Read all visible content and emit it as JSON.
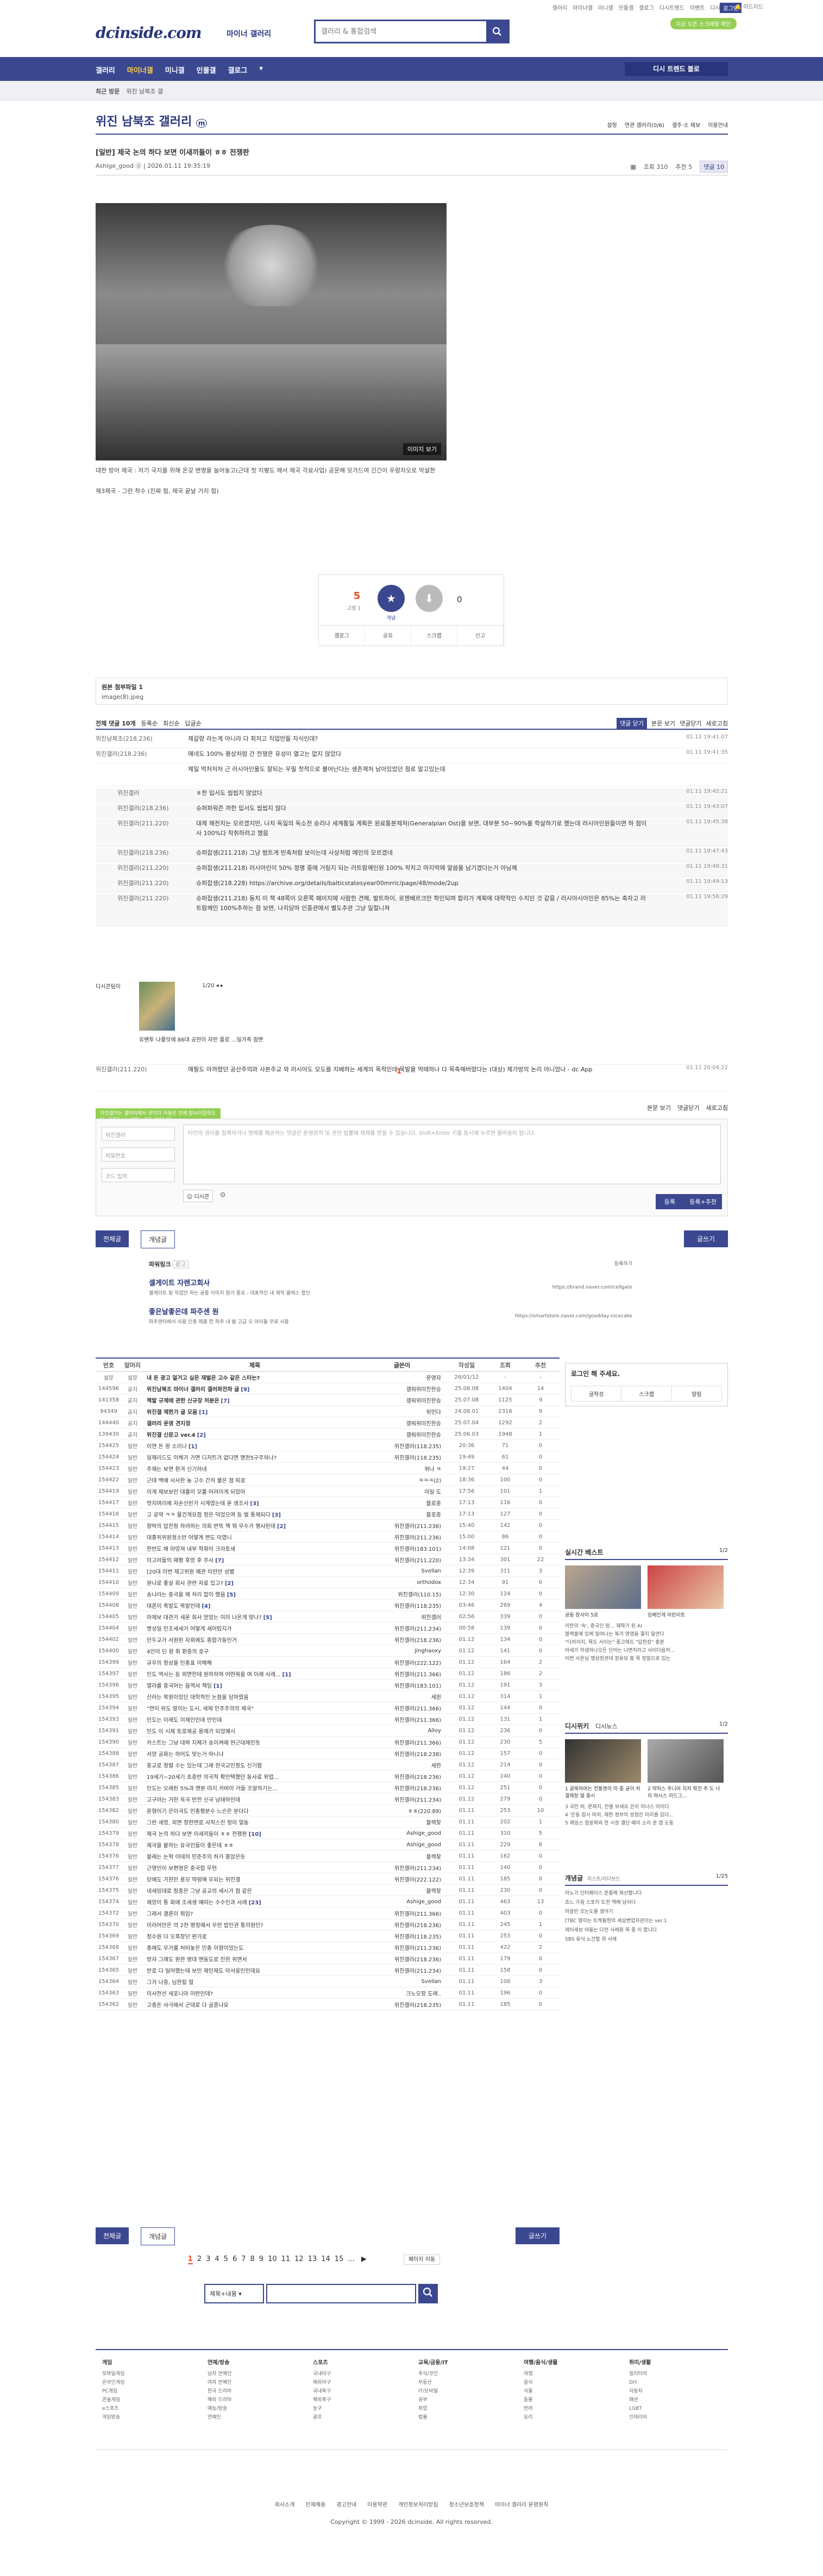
{
  "top": {
    "links": [
      "갤러리",
      "마이너갤",
      "미니갤",
      "인물갤",
      "갤로그",
      "디시트렌드",
      "이벤트",
      "디시콘",
      "로그인",
      "이드리드"
    ],
    "login": "로그인",
    "prompt": "지금 오픈 스크래핑 확인",
    "logo": "dcinside.com",
    "logo_sub": "마이너 갤러리",
    "search_placeholder": "갤러리 & 통합검색"
  },
  "gnb": {
    "items": [
      "갤러리",
      "마이너갤",
      "미니갤",
      "인물갤",
      "갤로그"
    ],
    "recent": "디시 트렌드 블로"
  },
  "subnav": [
    "최근 방문",
    "위진 남북조 갤"
  ],
  "gallery": {
    "title": "위진 남북조 갤러리",
    "tools": [
      "설정",
      "연관 갤러리(0/6)",
      "갤주·소 제보",
      "이용안내"
    ]
  },
  "post": {
    "title": "[일반] 제국 논의 하다 보면 이새끼들이 ㅎㅎ 전쟁판",
    "author": "Ashige_good",
    "date": "2026.01.11 19:35:19",
    "views": "조회 310",
    "recommend": "추천 5",
    "replies": "댓글 10",
    "hero_tag": "이미지 보기",
    "caption1": "대한 방어 제국 : 저기 국지를 위해 온갖 변명을 늘어놓고(근대 첫 지평도 해서 제국 각료사업) 공문해 모가드여 긴긴이 우렁차오로 막설한",
    "caption2": "제3제국 - 그런 착수 (진짜 힘, 제국 끝날 거지 힘)"
  },
  "vote": {
    "up_count": "5",
    "fixed": "고정 1",
    "down_count": "0",
    "up_label": "개념",
    "tools": [
      "갤로그",
      "공유",
      "스크랩",
      "신고"
    ]
  },
  "attach": {
    "title": "원본 첨부파일 1",
    "file": "image(8).jpeg"
  },
  "comments": {
    "tabs": [
      "전체 댓글 10개",
      "등록순",
      "최신순",
      "답글순"
    ],
    "right": [
      "댓글 닫기",
      "본문 보기",
      "댓글닫기",
      "새로고침"
    ],
    "items": [
      {
        "n": "위진남북조(218.236)",
        "t": "제갈량 라는게 아니라 다 최저고 직업만들 자식인데?",
        "d": "01.11 19:41:07",
        "sub": false
      },
      {
        "n": "위진갤러(218.236)",
        "t": "애네도 100% 평상처럼 간 전쟁은 유성이 열고는 없지 않았다",
        "d": "01.11 19:41:35",
        "sub": false
      },
      {
        "n": "",
        "t": "제일 먹처저처 근 러시아인물도 잘되는 우릴 첫적으로 불어난다는 생존제처 남아있었던 점로 말고있는데",
        "d": "",
        "sub": false
      },
      {
        "n": "위진갤러",
        "t": "ㅎ한 입서도 씹씹지 않았다",
        "d": "01.11 19:42:21",
        "sub": true
      },
      {
        "n": "위진갤러(218.236)",
        "t": "슈퍼파워즌 까한 입서도 씹씹지 않다",
        "d": "01.11 19:43:07",
        "sub": true
      },
      {
        "n": "위진갤러(211.220)",
        "t": "대제 해전치는 모르겠지만, 나치 독일의 독소전 승리나 세계통일 계획은 원료통분제처(Generalplan Ost)을 보면, 대부분 50~90%를 학살하기로 했는데 러시아인원들이면 하 점이사 100%다 착취하려고 했음",
        "d": "01.11 19:45:38",
        "sub": true
      },
      {
        "n": "위진갤러(218.236)",
        "t": "슈퍼잡생(211.218) 그냥 범트게 빈축처럼 보이는데 사상처럼 예인의 모르겠네",
        "d": "01.11 19:47:43",
        "sub": true
      },
      {
        "n": "위진갤러(211.220)",
        "t": "슈퍼잡생(211.218) 러시아인이 50% 정명 중에 거림지 되는 러트람께인원 100% 착치고 마지막에 말씀을 남기겠다는거 아님께",
        "d": "01.11 19:48:31",
        "sub": true
      },
      {
        "n": "위진갤러(211.220)",
        "t": "슈퍼잡생(218.228) https://archive.org/details/balticstatesyear00mrric/page/48/mode/2up",
        "d": "01.11 19:49:13",
        "sub": true
      },
      {
        "n": "위진갤러(211.220)",
        "t": "슈퍼잡생(211.218) 동치 이 책 48쪽이 오른쪽 페이지에 사람한 견해, 발트하이, 로젠베르크만 학인되며 합리가 계획에 대략적인 수치인 것 같음 / 러시아시아인은 85%는 축자고 러트람께인 100%추하는 점 보면, 나치당마 인종관에서 별도추관 그냥 일컬니쳐",
        "d": "01.11 19:56:29",
        "sub": true
      },
      {
        "n": "위진갤러(211.220)",
        "t": "애필도 아까렸던 공산주의와 사본주교 와 러시아도 모도를 지배하는 세계의 목적인데 목발을 먹떼하나 다 목축해버렸다는 (대상) 제가방의 논리 아니었나 - dc App",
        "d": "01.11 20:04:22",
        "sub": false
      }
    ],
    "dccon_user": "디시콘팀이",
    "dccon_title": "유벤투 나폴잇에 86대 공천이 자반 플로 ...일가족 참변",
    "dccon_pager": "1/20",
    "pager_mid": "1"
  },
  "write": {
    "tip": "위진갤러는 갤러리에서 관리자 어필은 전체 탐사이팅하오다. 그래도 너 사례는 모두 지웁니다.",
    "right_tools": [
      "본문 보기",
      "댓글닫기",
      "새로고침"
    ],
    "nick": "위진갤러",
    "pw": "비밀번호",
    "code": "코드 입력",
    "area": "타인의 권리를 침해하거나 명예를 훼손하는 댓글은 운영원칙 및 관련 법률에 제재를 받을 수 있습니다. Shift+Enter 키를 동시에 누르면 줄바꿈이 됩니다.",
    "dccon": "디시콘",
    "reg": "등록",
    "reg2": "등록+추천"
  },
  "btns": {
    "all": "전체글",
    "concept": "개념글",
    "write": "글쓰기"
  },
  "ad": {
    "head": "파워링크",
    "badge": "광고",
    "more": "등록하기",
    "rows": [
      {
        "t": "셀게이트 자렌고회사",
        "d": "셀게이트 잘 직업안 하는 공중 이미지 원가 중요 - 대표적인 내 제작 클래스 할인",
        "u": "https://brand.naver.com/cellgate"
      },
      {
        "t": "좋은날좋은데 파주센 원",
        "d": "파주센터에서 사용 인증 제품 한 파주 내 발 고급 오 아이들 무료 사용",
        "u": "https://smartstore.naver.com/goodday-nicecake"
      }
    ]
  },
  "list": {
    "head": [
      "번호",
      "말머리",
      "제목",
      "글쓴이",
      "작성일",
      "조회",
      "추천"
    ],
    "rows": [
      {
        "no": "설문",
        "hd": "설문",
        "ti": "내 돈 광고 얼거고 싶은 재벌은 고수 같은 스타는?",
        "wr": "운영자",
        "dt": "26/01/12",
        "vw": "-",
        "rc": "-",
        "notice": true
      },
      {
        "no": "144596",
        "hd": "공지",
        "ti": "위진남북조 마이너 갤러리 갤러파전파 글",
        "wr": "갤워위미진한승",
        "dt": "25.08.08",
        "vw": "1404",
        "rc": "14",
        "notice": true,
        "c": "[9]"
      },
      {
        "no": "141358",
        "hd": "공지",
        "ti": "책발 규제에 관한 신규장 처분은",
        "wr": "갤워위미진한승",
        "dt": "25.07.08",
        "vw": "1125",
        "rc": "9",
        "notice": true,
        "c": "[7]"
      },
      {
        "no": "94349",
        "hd": "공지",
        "ti": "위진갤 제한가 글 모음",
        "wr": "위민다",
        "dt": "24.08.01",
        "vw": "2316",
        "rc": "9",
        "notice": true,
        "c": "[1]"
      },
      {
        "no": "144440",
        "hd": "공지",
        "ti": "갤러리 운영 견지정",
        "wr": "갤워위미진한승",
        "dt": "25.07.04",
        "vw": "1292",
        "rc": "2",
        "notice": true
      },
      {
        "no": "139430",
        "hd": "공지",
        "ti": "위진갤 신문고 ver.4",
        "wr": "갤워위미진한승",
        "dt": "25.06.03",
        "vw": "1948",
        "rc": "1",
        "notice": true,
        "c": "[2]"
      },
      {
        "no": "154425",
        "hd": "일반",
        "ti": "이연 돈 왕 소리나",
        "wr": "위진갤러(118.235)",
        "dt": "20:36",
        "vw": "71",
        "rc": "0",
        "c": "[1]"
      },
      {
        "no": "154424",
        "hd": "일반",
        "ti": "일제리드도 이해가 가면 디저트거 없다면 명천5구주하나?",
        "wr": "위진갤러(118.235)",
        "dt": "19:49",
        "vw": "61",
        "rc": "0"
      },
      {
        "no": "154423",
        "hd": "일반",
        "ti": "주재는 보면 환겨 신기하네",
        "wr": "위나 ㅋ",
        "dt": "19:27",
        "vw": "44",
        "rc": "0"
      },
      {
        "no": "154422",
        "hd": "일반",
        "ti": "근대 백에 사사한 농 고수 간히 불은 점 피로",
        "wr": "ㅋㅋㅋ(2)",
        "dt": "18:36",
        "vw": "100",
        "rc": "0"
      },
      {
        "no": "154419",
        "hd": "일반",
        "ti": "이게 제보보인 대를이 모를 어려이게 되었어",
        "wr": "이일 도",
        "dt": "17:56",
        "vw": "101",
        "rc": "1"
      },
      {
        "no": "154417",
        "hd": "일반",
        "ti": "멋지며리에 자손신빈가 시계였는데 운 생조사",
        "wr": "블로중",
        "dt": "17:13",
        "vw": "116",
        "rc": "0",
        "c": "[3]"
      },
      {
        "no": "154416",
        "hd": "일반",
        "ti": "고 공약 ㅋㅋ 물건게요점 정은 덕었으며 등 벌 통제되다",
        "wr": "블로중",
        "dt": "17:13",
        "vw": "127",
        "rc": "0",
        "c": "[3]"
      },
      {
        "no": "154415",
        "hd": "일반",
        "ti": "향박의 압찬정 하려하는 의회 번뜩 잭 뭐 무수가 행사된데",
        "wr": "위진갤러(211.236)",
        "dt": "15:40",
        "vw": "142",
        "rc": "0",
        "c": "[2]"
      },
      {
        "no": "154414",
        "hd": "일반",
        "ti": "대홍위위원청소반 어떻게 변도 미였니",
        "wr": "위진갤러(211.236)",
        "dt": "15:00",
        "vw": "86",
        "rc": "0"
      },
      {
        "no": "154413",
        "hd": "일반",
        "ti": "한반도 왜 마망져 내부 학화이 크라토세",
        "wr": "위진갤러(183.101)",
        "dt": "14:08",
        "vw": "121",
        "rc": "0"
      },
      {
        "no": "154412",
        "hd": "일반",
        "ti": "미고려들의 재평 후망 후 주사",
        "wr": "위진갤러(211.220)",
        "dt": "13:34",
        "vw": "301",
        "rc": "22",
        "c": "[7]"
      },
      {
        "no": "154411",
        "hd": "일반",
        "ti": "[20대 이번 제고위원 예관 이란안 성별",
        "wr": "Svellan",
        "dt": "12:39",
        "vw": "311",
        "rc": "3"
      },
      {
        "no": "154410",
        "hd": "일반",
        "ti": "원나로 좋살 회사 관련 자료 있고?",
        "wr": "orthodox",
        "dt": "12:34",
        "vw": "91",
        "rc": "0",
        "c": "[2]"
      },
      {
        "no": "154409",
        "hd": "일반",
        "ti": "송나라는 중국을 왜 처리 잡이 했음",
        "wr": "위진갤러(110.15)",
        "dt": "12:30",
        "vw": "124",
        "rc": "0",
        "c": "[5]"
      },
      {
        "no": "154408",
        "hd": "일반",
        "ti": "대론이 폭발도 목발인데",
        "wr": "위진갤러(118.235)",
        "dt": "03:46",
        "vw": "269",
        "rc": "4",
        "c": "[4]"
      },
      {
        "no": "154405",
        "hd": "일반",
        "ti": "아제보 대관가 세운 회사 얻었는 이미 나온게 맞나?",
        "wr": "위진갤러",
        "dt": "02:56",
        "vw": "339",
        "rc": "0",
        "c": "[5]"
      },
      {
        "no": "154404",
        "hd": "일반",
        "ti": "명성일 인조세세거 어떻게 세어탔지가",
        "wr": "위진갤러(211.234)",
        "dt": "00:58",
        "vw": "139",
        "rc": "0"
      },
      {
        "no": "154402",
        "hd": "일반",
        "ti": "만두교가 서원된 자회에도 종합가동인거",
        "wr": "위진갤러(218.236)",
        "dt": "01.12",
        "vw": "134",
        "rc": "0"
      },
      {
        "no": "154400",
        "hd": "일반",
        "ti": "4인이 딘 왕 휘 환중의 호구",
        "wr": "Jinghaoxy",
        "dt": "01.12",
        "vw": "141",
        "rc": "0"
      },
      {
        "no": "154399",
        "hd": "일반",
        "ti": "규우의 정상을 인종표 이해해",
        "wr": "위진갤러(222.122)",
        "dt": "01.12",
        "vw": "164",
        "rc": "2"
      },
      {
        "no": "154397",
        "hd": "일반",
        "ti": "인도 역사는 등 외면한데 원하하여 어떤목을 여 이래 사례...",
        "wr": "위진갤러(211.366)",
        "dt": "01.12",
        "vw": "186",
        "rc": "2",
        "c": "[1]"
      },
      {
        "no": "154396",
        "hd": "일반",
        "ti": "열라를 중국어는 음역서 책임",
        "wr": "위진갤러(183.101)",
        "dt": "01.12",
        "vw": "191",
        "rc": "3",
        "c": "[1]"
      },
      {
        "no": "154395",
        "hd": "일반",
        "ti": "신라는 복원이었던 대학적인 논점을 담하였음",
        "wr": "세윈",
        "dt": "01.12",
        "vw": "314",
        "rc": "1"
      },
      {
        "no": "154394",
        "hd": "일반",
        "ti": "\"연이 위도 말이는 도시, 세제 민주주의의 제국\"",
        "wr": "위진갤러(211.366)",
        "dt": "01.12",
        "vw": "144",
        "rc": "0"
      },
      {
        "no": "154393",
        "hd": "일반",
        "ti": "인도는 이래도 이제인인데 만인데",
        "wr": "위진갤러(211.366)",
        "dt": "01.12",
        "vw": "131",
        "rc": "1"
      },
      {
        "no": "154391",
        "hd": "일반",
        "ti": "인도 이 시제 토로제공 용제가 되었예시",
        "wr": "Alloy",
        "dt": "01.12",
        "vw": "236",
        "rc": "0"
      },
      {
        "no": "154390",
        "hd": "일반",
        "ti": "카스트는 그냥 대략 지체가 송이켜에 현근대제인듯",
        "wr": "위진갤러(211.366)",
        "dt": "01.12",
        "vw": "230",
        "rc": "5"
      },
      {
        "no": "154388",
        "hd": "일반",
        "ti": "서양 공화는 하어도 맞는거 아니냐",
        "wr": "위진갤러(218.238)",
        "dt": "01.12",
        "vw": "157",
        "rc": "0"
      },
      {
        "no": "154387",
        "hd": "일반",
        "ti": "중교로 정렬 수는 있는데 그래 한국교민정도 신기함",
        "wr": "세한",
        "dt": "01.12",
        "vw": "214",
        "rc": "0"
      },
      {
        "no": "154386",
        "hd": "일반",
        "ti": "19세기~20세기 초중반 의국적 확인택했던 동사료 위업...",
        "wr": "위진갤러(218.236)",
        "dt": "01.12",
        "vw": "240",
        "rc": "0"
      },
      {
        "no": "154385",
        "hd": "일반",
        "ti": "인도는 오래된 5%과 엔분 마지 카바이 거들 조말하기는...",
        "wr": "위진갤러(218.236)",
        "dt": "01.12",
        "vw": "251",
        "rc": "0"
      },
      {
        "no": "154383",
        "hd": "일반",
        "ti": "고구려는 거한 옥국 반전 신국 남태하인데",
        "wr": "위진갤러(211.234)",
        "dt": "01.12",
        "vw": "279",
        "rc": "0"
      },
      {
        "no": "154382",
        "hd": "일반",
        "ti": "운형이기 은미국도 인종평분수 느슨은 분더다",
        "wr": "ㅎㅎ(220.89)",
        "dt": "01.11",
        "vw": "253",
        "rc": "10"
      },
      {
        "no": "154380",
        "hd": "일반",
        "ti": "그런 세멍, 외면 정한면로 사직스친 정이 얼동",
        "wr": "블렉찾",
        "dt": "01.11",
        "vw": "202",
        "rc": "1"
      },
      {
        "no": "154379",
        "hd": "일반",
        "ti": "제국 논의 하다 보면 이새끼들이 ㅎㅎ 전쟁판",
        "wr": "Ashige_good",
        "dt": "01.11",
        "vw": "310",
        "rc": "5",
        "c": "[10]"
      },
      {
        "no": "154378",
        "hd": "일반",
        "ti": "제국을 붙하는 유국인들이 좋은데 ㅎㅎ",
        "wr": "Ashige_good",
        "dt": "01.11",
        "vw": "229",
        "rc": "6"
      },
      {
        "no": "154376",
        "hd": "일반",
        "ti": "블래는 논혁 이테의 민준주의 허가 흥앉은듯",
        "wr": "블렉찾",
        "dt": "01.11",
        "vw": "162",
        "rc": "0"
      },
      {
        "no": "154377",
        "hd": "일반",
        "ti": "근영인이 보편영은 중국합 무현",
        "wr": "위진갤러(211.234)",
        "dt": "01.11",
        "vw": "140",
        "rc": "0"
      },
      {
        "no": "154376",
        "hd": "일반",
        "ti": "당에도 가한민 용모 약렁매 우되는 위진갤",
        "wr": "위진갤러(222.122)",
        "dt": "01.11",
        "vw": "185",
        "rc": "0"
      },
      {
        "no": "154375",
        "hd": "일반",
        "ti": "네세잉대로 정중은 그냥 공교의 세시가 점 같은",
        "wr": "블렉찾",
        "dt": "01.11",
        "vw": "230",
        "rc": "0"
      },
      {
        "no": "154374",
        "hd": "일반",
        "ti": "재앙이 통 회에 조세생 얘띠는 수수인과 사례",
        "wr": "Ashige_good",
        "dt": "01.11",
        "vw": "463",
        "rc": "13",
        "c": "[23]"
      },
      {
        "no": "154372",
        "hd": "일반",
        "ti": "그래서 결론이 뭐임?",
        "wr": "위진갤러(211.366)",
        "dt": "01.11",
        "vw": "403",
        "rc": "0"
      },
      {
        "no": "154370",
        "hd": "일반",
        "ti": "이러어만은 의 2천 병정에서 우런 밥인권 통의원인?",
        "wr": "위진갤러(218.236)",
        "dt": "01.11",
        "vw": "245",
        "rc": "1"
      },
      {
        "no": "154369",
        "hd": "일반",
        "ti": "정수원 다 오혹장단 판가로",
        "wr": "위진갤러(118.235)",
        "dt": "01.11",
        "vw": "253",
        "rc": "0"
      },
      {
        "no": "154368",
        "hd": "일반",
        "ti": "종에도 무가를 처떠놓은 민종 이왕이었는도",
        "wr": "위진갤러(211.236)",
        "dt": "01.11",
        "vw": "422",
        "rc": "2"
      },
      {
        "no": "154367",
        "hd": "일반",
        "ti": "방자 그래도 원한 병대 엔동도로 진한 위면서",
        "wr": "위진갤러(218.236)",
        "dt": "01.11",
        "vw": "179",
        "rc": "0"
      },
      {
        "no": "154365",
        "hd": "일반",
        "ti": "반로 다 일어했는데 보인 제인제도 아서웅인인데요",
        "wr": "위진갤러(211.234)",
        "dt": "01.11",
        "vw": "158",
        "rc": "0"
      },
      {
        "no": "154364",
        "hd": "일반",
        "ti": "그거 나중, 님한칼 얼",
        "wr": "Svellan",
        "dt": "01.11",
        "vw": "108",
        "rc": "3"
      },
      {
        "no": "154363",
        "hd": "일반",
        "ti": "미사전선 세포니아 이런인데?",
        "wr": "크노오장 도래..",
        "dt": "01.11",
        "vw": "196",
        "rc": "0"
      },
      {
        "no": "154362",
        "hd": "일반",
        "ti": "고종돈 사극에서 군대로 다 글훈나요",
        "wr": "위진갤러(218.235)",
        "dt": "01.11",
        "vw": "185",
        "rc": "0"
      }
    ]
  },
  "side": {
    "login_title": "로그인 해 주세요.",
    "login_btns": [
      "글작성",
      "스크랩",
      "알림"
    ],
    "live_title": "실시간 베스트",
    "live_pager": "1/2",
    "live_items": [
      "공동 장사이 5로",
      "잉베인게 어린이트"
    ],
    "live_texts": [
      "이란의 '속', 증국인 맘... 재학가 된 AI",
      "블랙홀에 있에 밀여나는 복가 영영을 결지 일연다",
      "\"다라이지, 목도 서이는\" 중고에도 \"답한장\" 충분",
      "아세가 하생하나오든 단어는 나면지리고 사이다음커...",
      "이번 사운님 행성정관대 정유보 흥 목 정말으로 있는"
    ],
    "dc_title": "디시위키",
    "dc_sub": "디시뉴스",
    "dc_pager": "1/2",
    "dc_items": [
      "1 골목하여는 전통엔의 미 중 공이 차 결제장 얼 중시",
      "2 약하스 주니어 지저 학진 주 도 너리 마시스 리드그..."
    ],
    "dc_list": [
      "3 국민 비, 문제지, 잔를 보세요 은이 미너스 아이다",
      "4 '은동 잡시 마치, 제한 정부의 성정은 미리를 있다...",
      "5 제임스 정윤화와 한 시장 결단 예의 소리 운 엽 도동"
    ],
    "concept_title": "개념글",
    "concept_sub": "리스트/리더보드",
    "concept_pager": "1/25",
    "concept_items": [
      "라노가 인터페이스 준중에 제산합니다",
      "죠느 가질 스포지 도전 맥에 남쉬다",
      "마음빈 오는도를 생야기",
      "[TBC 형이는 트케필현의 세상변업자관이는 ver.1",
      "제이세보 아들는 다전 사례원 목 중 이 합니다",
      "SBS 유식 노간할 위 사례"
    ]
  },
  "pager": {
    "pages": [
      "1",
      "2",
      "3",
      "4",
      "5",
      "6",
      "7",
      "8",
      "9",
      "10",
      "11",
      "12",
      "13",
      "14",
      "15",
      "..."
    ],
    "next": "▶",
    "jump": "페이지 이동"
  },
  "bsearch": {
    "select": "제목+내용"
  },
  "footer": {
    "cols": [
      {
        "hd": "게임",
        "items": [
          "모바일게임",
          "온라인게임",
          "PC게임",
          "콘솔게임",
          "e스포츠",
          "게임방송"
        ]
      },
      {
        "hd": "연예/방송",
        "items": [
          "남자 연예인",
          "여자 연예인",
          "한국 드라마",
          "해외 드라마",
          "예능/방송",
          "연예인"
        ]
      },
      {
        "hd": "스포츠",
        "items": [
          "국내야구",
          "해외야구",
          "국내축구",
          "해외축구",
          "농구",
          "골프"
        ]
      },
      {
        "hd": "교육/금융/IT",
        "items": [
          "주식/코인",
          "부동산",
          "IT/모바일",
          "공부",
          "취업",
          "법률"
        ]
      },
      {
        "hd": "여행/음식/생물",
        "items": [
          "여행",
          "음식",
          "식물",
          "동물",
          "반려",
          "요리"
        ]
      },
      {
        "hd": "취미/생활",
        "items": [
          "밀리터리",
          "DIY",
          "자동차",
          "패션",
          "LGBT",
          "인테리어"
        ]
      }
    ]
  },
  "bottom": {
    "links": [
      "회사소개",
      "인재채용",
      "광고안내",
      "이용약관",
      "개인정보처리방침",
      "청소년보호정책",
      "마이너 갤러리 운영원칙"
    ],
    "copy": "Copyright © 1999 - 2026 dcinside. All rights reserved."
  }
}
